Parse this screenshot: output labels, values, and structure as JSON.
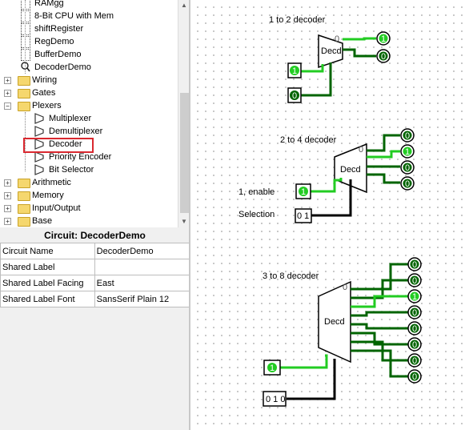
{
  "explorer": {
    "items": [
      {
        "label": "RAMgg",
        "kind": "circuit"
      },
      {
        "label": "8-Bit CPU with Mem",
        "kind": "circuit"
      },
      {
        "label": "shiftRegister",
        "kind": "circuit"
      },
      {
        "label": "RegDemo",
        "kind": "circuit"
      },
      {
        "label": "BufferDemo",
        "kind": "circuit"
      },
      {
        "label": "DecoderDemo",
        "kind": "circuit-active"
      },
      {
        "label": "Wiring",
        "kind": "folder"
      },
      {
        "label": "Gates",
        "kind": "folder"
      },
      {
        "label": "Plexers",
        "kind": "folder-open"
      },
      {
        "label": "Multiplexer",
        "kind": "component"
      },
      {
        "label": "Demultiplexer",
        "kind": "component"
      },
      {
        "label": "Decoder",
        "kind": "component-selected"
      },
      {
        "label": "Priority Encoder",
        "kind": "component"
      },
      {
        "label": "Bit Selector",
        "kind": "component"
      },
      {
        "label": "Arithmetic",
        "kind": "folder"
      },
      {
        "label": "Memory",
        "kind": "folder"
      },
      {
        "label": "Input/Output",
        "kind": "folder"
      },
      {
        "label": "Base",
        "kind": "folder"
      }
    ]
  },
  "attributes": {
    "title": "Circuit: DecoderDemo",
    "rows": [
      {
        "name": "Circuit Name",
        "value": "DecoderDemo"
      },
      {
        "name": "Shared Label",
        "value": ""
      },
      {
        "name": "Shared Label Facing",
        "value": "East"
      },
      {
        "name": "Shared Label Font",
        "value": "SansSerif Plain 12"
      }
    ]
  },
  "canvas": {
    "decoder1": {
      "title": "1 to 2 decoder",
      "box": "Decd",
      "sel_index": "0",
      "input_bit": "1",
      "enable_bit": "0",
      "outputs": [
        "1",
        "0"
      ]
    },
    "decoder2": {
      "title": "2 to 4 decoder",
      "box": "Decd",
      "sel_index": "0",
      "enable_label": "1, enable",
      "enable_bit": "1",
      "selection_label": "Selection",
      "selection_value": "0 1",
      "outputs": [
        "0",
        "1",
        "0",
        "0"
      ]
    },
    "decoder3": {
      "title": "3 to 8 decoder",
      "box": "Decd",
      "sel_index": "0",
      "enable_bit": "1",
      "selection_value": "0 1 0",
      "outputs": [
        "0",
        "0",
        "1",
        "0",
        "0",
        "0",
        "0",
        "0"
      ]
    },
    "colors": {
      "wire_on": "#22cc22",
      "wire_off": "#006400",
      "wire_bus": "#000000",
      "highlight": "#d9282f"
    }
  }
}
